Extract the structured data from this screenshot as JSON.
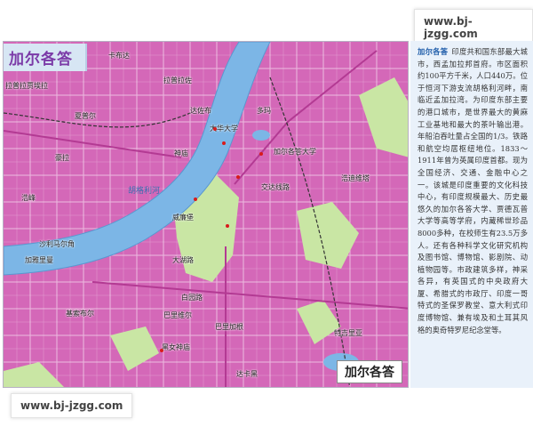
{
  "watermark_top": "www.bj-jzgg.com",
  "watermark_bottom": "www.bj-jzgg.com",
  "map": {
    "title": "加尔各答",
    "city_box": "加尔各答",
    "colors": {
      "urban": "#d468b8",
      "park": "#c9e6a4",
      "water": "#7cb6e6",
      "background": "#ffffff"
    },
    "labels": [
      {
        "id": "lapujiuye",
        "text": "拉普拉贾埃拉"
      },
      {
        "id": "xiangpuer",
        "text": "夏普尔"
      },
      {
        "id": "haola",
        "text": "豪拉"
      },
      {
        "id": "lapuzuo",
        "text": "拉普拉佐"
      },
      {
        "id": "kabuda",
        "text": "卡布达"
      },
      {
        "id": "dazaoshibu",
        "text": "达佐布"
      },
      {
        "id": "duoma",
        "text": "多玛"
      },
      {
        "id": "haodiweita",
        "text": "浩迪维塔"
      },
      {
        "id": "shenjing",
        "text": "神庙"
      },
      {
        "id": "dahua",
        "text": "大华大学"
      },
      {
        "id": "jiaoda",
        "text": "加尔各答大学"
      },
      {
        "id": "jiaoda2",
        "text": "交达线路"
      },
      {
        "id": "haofeng",
        "text": "浩峰"
      },
      {
        "id": "weiji",
        "text": "威廉堡"
      },
      {
        "id": "sbmal",
        "text": "沙利马尔角"
      },
      {
        "id": "jiaer",
        "text": "加雅里曼"
      },
      {
        "id": "jisuo",
        "text": "基索布尔"
      },
      {
        "id": "baiyuan",
        "text": "白园路"
      },
      {
        "id": "bali",
        "text": "巴里加根"
      },
      {
        "id": "baiqi",
        "text": "巴里维尔"
      },
      {
        "id": "heimiao",
        "text": "黑女神庙"
      },
      {
        "id": "tejiya",
        "text": "特吉里亚"
      },
      {
        "id": "daluo",
        "text": "达卡黑"
      },
      {
        "id": "hooghly",
        "text": "胡格利河"
      },
      {
        "id": "daqiao",
        "text": "大湖路"
      }
    ]
  },
  "description": {
    "name": "加尔各答",
    "text": "印度共和国东部最大城市，西孟加拉邦首府。市区面积约100平方千米，人口440万。位于恒河下游支流胡格利河畔，南临近孟加拉湾。为印度东部主要的港口城市，是世界最大的黄麻工业基地和最大的茶叶输出港。年船泊吞吐量占全国的1/3。铁路和航空均居枢纽地位。1833～1911年曾为英属印度首都。现为全国经济、交通、金融中心之一。该城是印度重要的文化科技中心，有印度规模最大、历史最悠久的加尔各答大学、贾德瓦普大学等高等学府，内藏稀世珍品8000多种，在校师生有23.5万多人。还有各种科学文化研究机构及图书馆、博物馆、影剧院、动植物园等。市政建筑多样，神采各异，有英国式的中央政府大厦、希腊式的市政厅、印度一哥特式的圣保罗教堂、意大利式印度博物馆、兼有埃及和土耳其风格的奥奇特罗尼纪念堂等。"
  }
}
